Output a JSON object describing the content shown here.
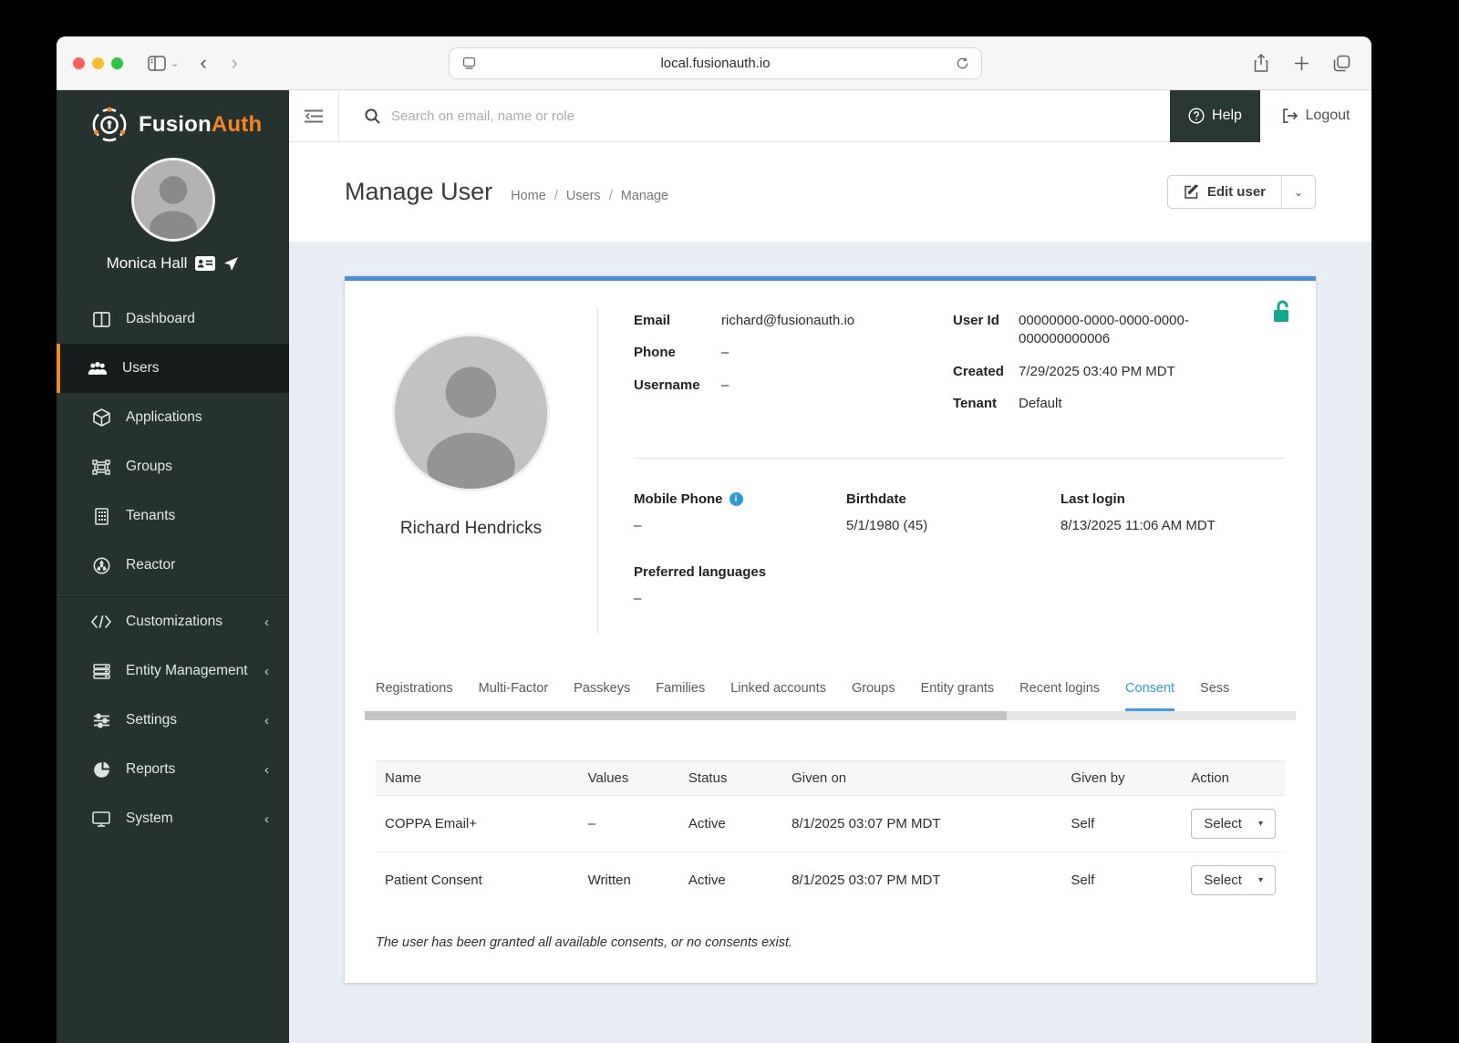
{
  "browser": {
    "url": "local.fusionauth.io"
  },
  "topbar": {
    "search_placeholder": "Search on email, name or role",
    "help": "Help",
    "logout": "Logout"
  },
  "sidebar": {
    "brand_fusion": "Fusion",
    "brand_auth": "Auth",
    "profile_name": "Monica Hall",
    "items": [
      {
        "label": "Dashboard",
        "icon": "dashboard-icon"
      },
      {
        "label": "Users",
        "icon": "users-icon",
        "active": true
      },
      {
        "label": "Applications",
        "icon": "cube-icon"
      },
      {
        "label": "Groups",
        "icon": "object-group-icon"
      },
      {
        "label": "Tenants",
        "icon": "building-icon"
      },
      {
        "label": "Reactor",
        "icon": "reactor-icon"
      }
    ],
    "groups": [
      {
        "label": "Customizations",
        "icon": "code-icon",
        "chevron": "‹"
      },
      {
        "label": "Entity Management",
        "icon": "server-icon",
        "chevron": "‹"
      },
      {
        "label": "Settings",
        "icon": "sliders-icon",
        "chevron": "‹"
      },
      {
        "label": "Reports",
        "icon": "pie-chart-icon",
        "chevron": "‹"
      },
      {
        "label": "System",
        "icon": "monitor-icon",
        "chevron": "‹"
      }
    ]
  },
  "page": {
    "title": "Manage User",
    "breadcrumb": [
      "Home",
      "Users",
      "Manage"
    ],
    "sep": "/",
    "edit_button": "Edit user"
  },
  "user": {
    "display_name": "Richard Hendricks",
    "email_label": "Email",
    "email": "richard@fusionauth.io",
    "phone_label": "Phone",
    "phone": "–",
    "username_label": "Username",
    "username": "–",
    "user_id_label": "User Id",
    "user_id": "00000000-0000-0000-0000-000000000006",
    "created_label": "Created",
    "created": "7/29/2025 03:40 PM MDT",
    "tenant_label": "Tenant",
    "tenant": "Default",
    "mobile_phone_label": "Mobile Phone",
    "mobile_phone": "–",
    "birthdate_label": "Birthdate",
    "birthdate": "5/1/1980 (45)",
    "last_login_label": "Last login",
    "last_login": "8/13/2025 11:06 AM MDT",
    "preferred_languages_label": "Preferred languages",
    "preferred_languages": "–"
  },
  "tabs": [
    {
      "label": "Registrations"
    },
    {
      "label": "Multi-Factor"
    },
    {
      "label": "Passkeys"
    },
    {
      "label": "Families"
    },
    {
      "label": "Linked accounts"
    },
    {
      "label": "Groups"
    },
    {
      "label": "Entity grants"
    },
    {
      "label": "Recent logins"
    },
    {
      "label": "Consent",
      "active": true
    },
    {
      "label": "Sess"
    }
  ],
  "consents": {
    "columns": [
      "Name",
      "Values",
      "Status",
      "Given on",
      "Given by",
      "Action"
    ],
    "rows": [
      {
        "name": "COPPA Email+",
        "values": "–",
        "status": "Active",
        "given_on": "8/1/2025 03:07 PM MDT",
        "given_by": "Self",
        "action": "Select"
      },
      {
        "name": "Patient Consent",
        "values": "Written",
        "status": "Active",
        "given_on": "8/1/2025 03:07 PM MDT",
        "given_by": "Self",
        "action": "Select"
      }
    ],
    "footnote": "The user has been granted all available consents, or no consents exist."
  },
  "colors": {
    "sidebar_bg": "#263230",
    "accent_orange": "#f5861f",
    "active_tab_blue": "#2e9fe0",
    "card_top_border": "#4a90d2",
    "lock_teal": "#13a98e",
    "info_icon_blue": "#2d9cdb",
    "content_bg": "#e8ecf3"
  }
}
